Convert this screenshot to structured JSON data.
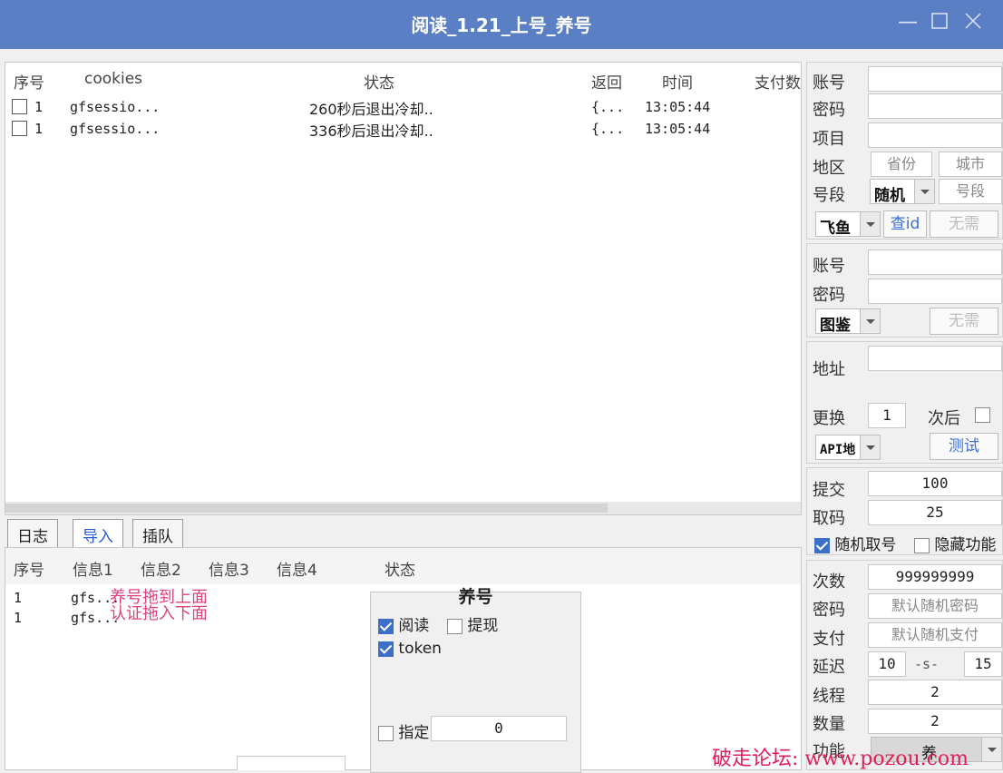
{
  "window": {
    "title": "阅读_1.21_上号_养号",
    "min_icon": "minimize-icon",
    "max_icon": "maximize-icon",
    "close_icon": "close-icon"
  },
  "main_table": {
    "columns": [
      "序号",
      "cookies",
      "状态",
      "返回",
      "时间",
      "支付数"
    ],
    "rows": [
      {
        "seq": "1",
        "cookies": "gfsessio...",
        "status": "260秒后退出冷却..",
        "ret": "{...",
        "time": "13:05:44"
      },
      {
        "seq": "1",
        "cookies": "gfsessio...",
        "status": "336秒后退出冷却..",
        "ret": "{...",
        "time": "13:05:44"
      }
    ]
  },
  "tabs": [
    "日志",
    "导入",
    "插队"
  ],
  "lower_table": {
    "columns": [
      "序号",
      "信息1",
      "信息2",
      "信息3",
      "信息4",
      "状态"
    ],
    "rows": [
      {
        "seq": "1",
        "info1": "gfs..."
      },
      {
        "seq": "1",
        "info1": "gfs..."
      }
    ],
    "hint1": "养号拖到上面",
    "hint2": "认证拖入下面"
  },
  "yanghao": {
    "title": "养号",
    "read_label": "阅读",
    "withdraw_label": "提现",
    "token_label": "token",
    "assign_label": "指定",
    "assign_value": "0"
  },
  "right_panel": {
    "g1": {
      "account": "账号",
      "password": "密码",
      "project": "项目",
      "region": "地区",
      "province": "省份",
      "city": "城市",
      "segment": "号段",
      "segment_combo": "随机",
      "segment_field": "号段",
      "platform_combo": "飞鱼",
      "check_id": "查id",
      "no_need": "无需"
    },
    "g2": {
      "account": "账号",
      "password": "密码",
      "captcha_combo": "图鉴",
      "no_need": "无需"
    },
    "g3": {
      "address": "地址",
      "change": "更换",
      "change_value": "1",
      "after": "次后",
      "api_combo": "API地",
      "test": "测试"
    },
    "g4": {
      "submit": "提交",
      "submit_value": "100",
      "getcode": "取码",
      "getcode_value": "25",
      "random_label": "随机取号",
      "hide_label": "隐藏功能"
    },
    "g5": {
      "count": "次数",
      "count_value": "999999999",
      "password": "密码",
      "password_value": "默认随机密码",
      "pay": "支付",
      "pay_value": "默认随机支付",
      "delay": "延迟",
      "delay_from": "10",
      "delay_sep": "-s-",
      "delay_to": "15",
      "threads": "线程",
      "threads_value": "2",
      "amount": "数量",
      "amount_value": "2",
      "function": "功能",
      "function_combo": "养"
    }
  },
  "watermark": "破走论坛: www.pozou.com",
  "colors": {
    "titlebar": "#5b7fc4",
    "accent": "#3d6fc9",
    "pink": "#e0407e"
  }
}
